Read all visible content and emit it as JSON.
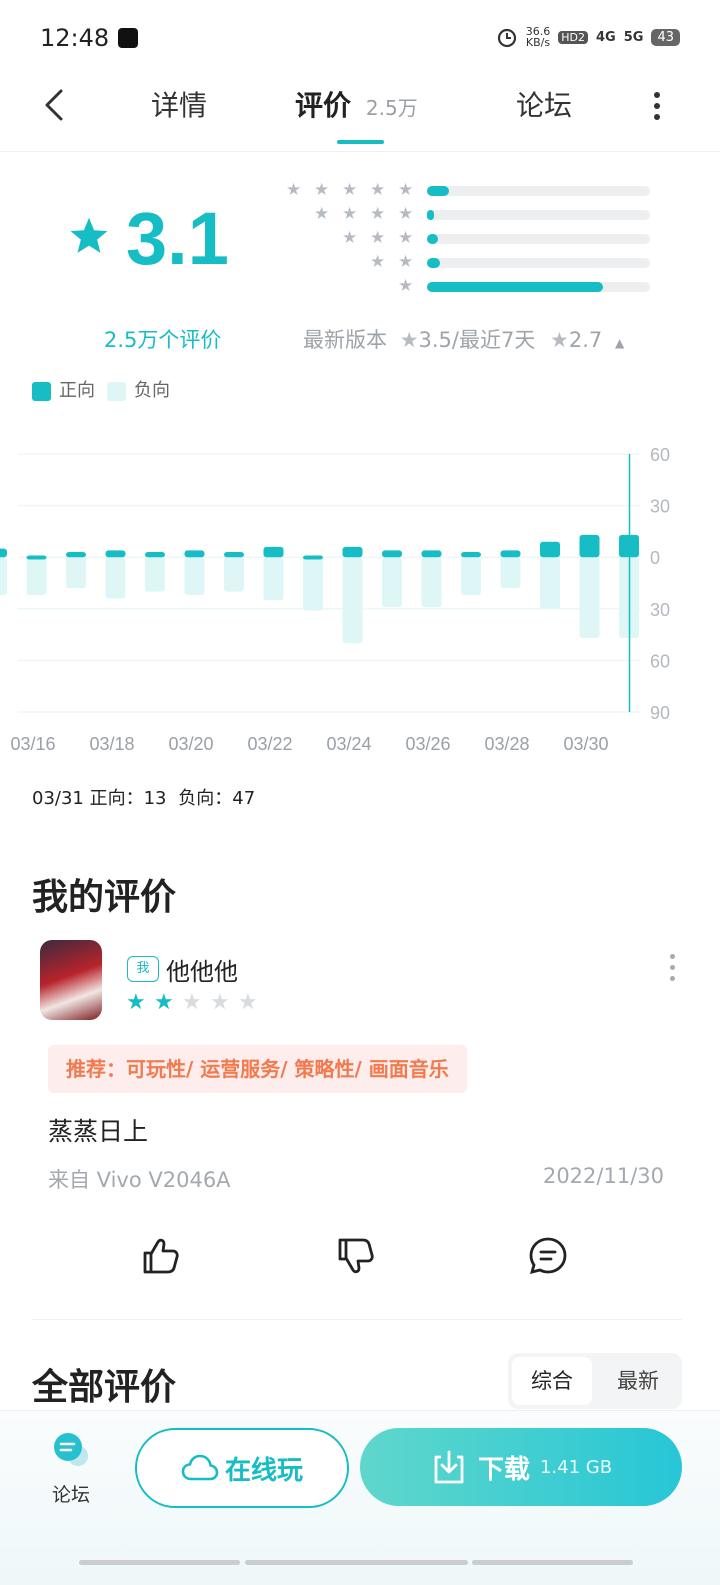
{
  "status_bar": {
    "time": "12:48",
    "net_speed": "36.6",
    "net_unit": "KB/s",
    "hd": "HD2",
    "sig1": "4G",
    "sig2": "5G",
    "battery": "43"
  },
  "header": {
    "tab_detail": "详情",
    "tab_reviews": "评价",
    "review_count": "2.5万",
    "tab_forum": "论坛"
  },
  "rating": {
    "score": "3.1",
    "count_label": "2.5万个评价",
    "latest_version_label": "最新版本",
    "latest_version_score": "3.5",
    "recent_label": "/最近7天",
    "recent_score": "2.7",
    "distribution": [
      {
        "stars": 5,
        "fraction": 0.1
      },
      {
        "stars": 4,
        "fraction": 0.03
      },
      {
        "stars": 3,
        "fraction": 0.05
      },
      {
        "stars": 2,
        "fraction": 0.06
      },
      {
        "stars": 1,
        "fraction": 0.79
      }
    ]
  },
  "legend": {
    "positive": "正向",
    "negative": "负向"
  },
  "colors": {
    "accent": "#16bdc4",
    "negative": "#dff6f7",
    "tag_text": "#f17a4f",
    "tag_bg": "#fdeeed"
  },
  "chart_data": {
    "type": "bar",
    "categories": [
      "03/15",
      "03/16",
      "03/17",
      "03/18",
      "03/19",
      "03/20",
      "03/21",
      "03/22",
      "03/23",
      "03/24",
      "03/25",
      "03/26",
      "03/27",
      "03/28",
      "03/29",
      "03/30",
      "03/31"
    ],
    "x_tick_labels": [
      "03/16",
      "03/18",
      "03/20",
      "03/22",
      "03/24",
      "03/26",
      "03/28",
      "03/30"
    ],
    "y_tick_labels": [
      "60",
      "30",
      "0",
      "30",
      "60",
      "90"
    ],
    "ylim": [
      -90,
      60
    ],
    "series": [
      {
        "name": "正向",
        "values": [
          5,
          1,
          3,
          4,
          3,
          4,
          3,
          6,
          1,
          6,
          4,
          4,
          3,
          4,
          9,
          13,
          13
        ]
      },
      {
        "name": "负向",
        "values": [
          22,
          22,
          18,
          24,
          20,
          22,
          20,
          25,
          31,
          50,
          29,
          29,
          22,
          18,
          30,
          47,
          47
        ]
      }
    ],
    "highlight_index": 16,
    "title": "",
    "xlabel": "",
    "ylabel": ""
  },
  "chart_tip": {
    "date": "03/31",
    "pos_label": "正向：",
    "pos_value": "13",
    "neg_label": "负向：",
    "neg_value": "47"
  },
  "my_review": {
    "title": "我的评价",
    "me_badge": "我",
    "username": "他他他",
    "rating": 2,
    "tags": "推荐：可玩性/ 运营服务/ 策略性/ 画面音乐",
    "text": "蒸蒸日上",
    "device": "来自 Vivo V2046A",
    "date": "2022/11/30"
  },
  "all_reviews": {
    "title": "全部评价",
    "sort_comprehensive": "综合",
    "sort_latest": "最新"
  },
  "bottom_bar": {
    "forum_label": "论坛",
    "online_play": "在线玩",
    "download": "下载",
    "size": "1.41 GB"
  }
}
